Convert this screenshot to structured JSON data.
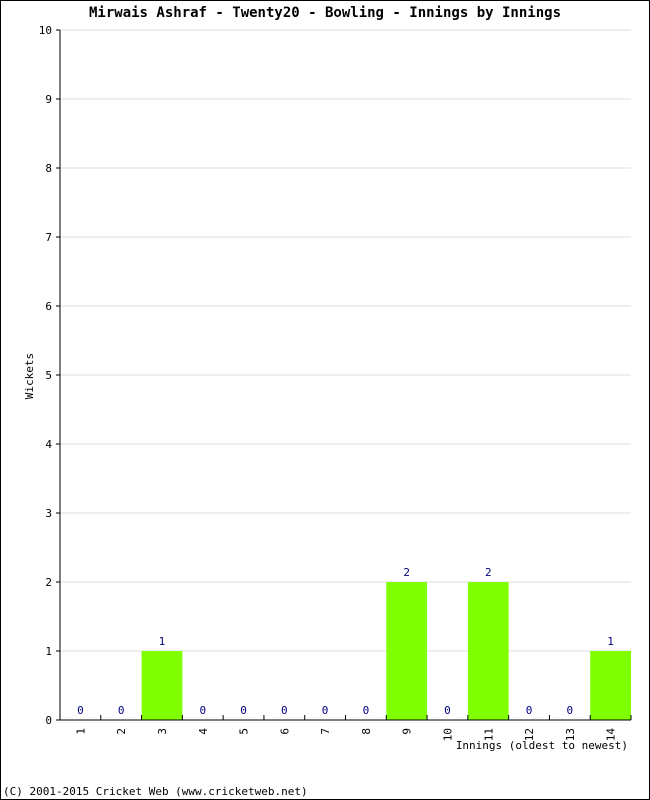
{
  "chart_data": {
    "type": "bar",
    "title": "Mirwais Ashraf - Twenty20 - Bowling - Innings by Innings",
    "xlabel": "Innings (oldest to newest)",
    "ylabel": "Wickets",
    "ylim": [
      0,
      10
    ],
    "yticks": [
      "0",
      "1",
      "2",
      "3",
      "4",
      "5",
      "6",
      "7",
      "8",
      "9",
      "10"
    ],
    "categories": [
      "1",
      "2",
      "3",
      "4",
      "5",
      "6",
      "7",
      "8",
      "9",
      "10",
      "11",
      "12",
      "13",
      "14"
    ],
    "values": [
      0,
      0,
      1,
      0,
      0,
      0,
      0,
      0,
      2,
      0,
      2,
      0,
      0,
      1
    ],
    "grid": true,
    "bar_color": "#80ff00",
    "label_color": "#000080"
  },
  "footer": "(C) 2001-2015 Cricket Web (www.cricketweb.net)"
}
